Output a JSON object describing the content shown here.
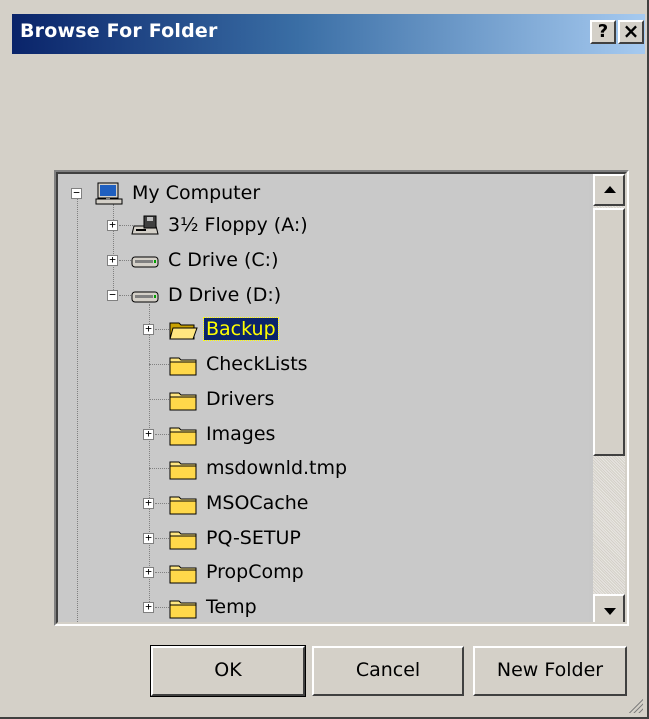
{
  "window": {
    "title": "Browse For Folder",
    "help_label": "?",
    "close_label": "×"
  },
  "tree": {
    "root": {
      "label": "My Computer",
      "icon": "computer-icon",
      "expander": "−"
    },
    "drives": [
      {
        "label": "3½ Floppy (A:)",
        "icon": "floppy-drive-icon",
        "expander": "+"
      },
      {
        "label": "C Drive (C:)",
        "icon": "hard-drive-icon",
        "expander": "+"
      },
      {
        "label": "D Drive (D:)",
        "icon": "hard-drive-icon",
        "expander": "−"
      }
    ],
    "folders": [
      {
        "label": "Backup",
        "icon": "open-folder-icon",
        "expander": "+",
        "selected": true
      },
      {
        "label": "CheckLists",
        "icon": "folder-icon",
        "expander": ""
      },
      {
        "label": "Drivers",
        "icon": "folder-icon",
        "expander": ""
      },
      {
        "label": "Images",
        "icon": "folder-icon",
        "expander": "+"
      },
      {
        "label": "msdownld.tmp",
        "icon": "folder-icon",
        "expander": ""
      },
      {
        "label": "MSOCache",
        "icon": "folder-icon",
        "expander": "+"
      },
      {
        "label": "PQ-SETUP",
        "icon": "folder-icon",
        "expander": "+"
      },
      {
        "label": "PropComp",
        "icon": "folder-icon",
        "expander": "+"
      },
      {
        "label": "Temp",
        "icon": "folder-icon",
        "expander": "+"
      }
    ]
  },
  "buttons": {
    "ok": "OK",
    "cancel": "Cancel",
    "new_folder": "New Folder"
  },
  "colors": {
    "selection_bg": "#0a246a",
    "selection_text": "#ffff00",
    "dialog_bg": "#d4d0c8"
  }
}
